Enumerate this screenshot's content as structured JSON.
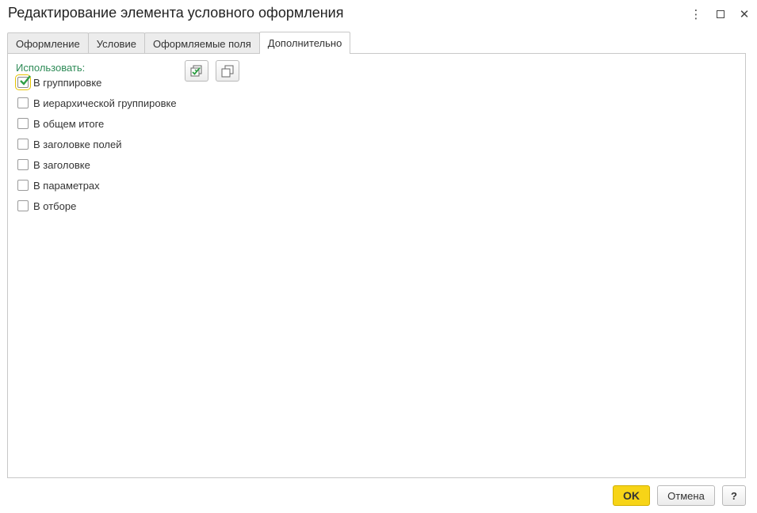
{
  "window": {
    "title": "Редактирование элемента условного оформления",
    "controls": {
      "more": "⋮",
      "close": "✕"
    }
  },
  "tabs": [
    {
      "label": "Оформление",
      "active": false
    },
    {
      "label": "Условие",
      "active": false
    },
    {
      "label": "Оформляемые поля",
      "active": false
    },
    {
      "label": "Дополнительно",
      "active": true
    }
  ],
  "panel": {
    "use_label": "Использовать:",
    "toolbar": {
      "check_all_icon": "check-all-icon",
      "uncheck_all_icon": "uncheck-all-icon"
    },
    "options": [
      {
        "label": "В группировке",
        "checked": true
      },
      {
        "label": "В иерархической группировке",
        "checked": false
      },
      {
        "label": "В общем итоге",
        "checked": false
      },
      {
        "label": "В заголовке полей",
        "checked": false
      },
      {
        "label": "В заголовке",
        "checked": false
      },
      {
        "label": "В параметрах",
        "checked": false
      },
      {
        "label": "В отборе",
        "checked": false
      }
    ]
  },
  "footer": {
    "ok_label": "OK",
    "cancel_label": "Отмена",
    "help_label": "?"
  },
  "colors": {
    "accent_green": "#2e8b57",
    "ok_yellow": "#f7d417",
    "check_green": "#2f9e44"
  }
}
